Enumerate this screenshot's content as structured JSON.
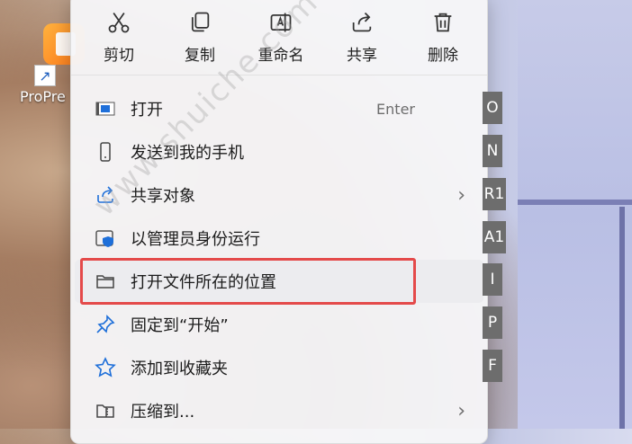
{
  "desktop": {
    "icon_label": "ProPre",
    "shortcut_icon": "shortcut-arrow-icon"
  },
  "toolbar": {
    "items": [
      {
        "label": "剪切",
        "icon": "scissors-icon"
      },
      {
        "label": "复制",
        "icon": "copy-icon"
      },
      {
        "label": "重命名",
        "icon": "rename-icon"
      },
      {
        "label": "共享",
        "icon": "share-icon"
      },
      {
        "label": "删除",
        "icon": "trash-icon"
      }
    ]
  },
  "menu": {
    "items": [
      {
        "label": "打开",
        "shortcut": "Enter",
        "hotkey": "O",
        "icon": "open-app-icon",
        "submenu": false
      },
      {
        "label": "发送到我的手机",
        "hotkey": "N",
        "icon": "phone-icon",
        "submenu": false
      },
      {
        "label": "共享对象",
        "hotkey": "R1",
        "icon": "share-icon",
        "submenu": true
      },
      {
        "label": "以管理员身份运行",
        "hotkey": "A1",
        "icon": "shield-icon",
        "submenu": false
      },
      {
        "label": "打开文件所在的位置",
        "hotkey": "I",
        "icon": "folder-icon",
        "submenu": false,
        "highlighted": true
      },
      {
        "label": "固定到“开始”",
        "hotkey": "P",
        "icon": "pin-icon",
        "submenu": false
      },
      {
        "label": "添加到收藏夹",
        "hotkey": "F",
        "icon": "star-icon",
        "submenu": false
      },
      {
        "label": "压缩到...",
        "icon": "zip-folder-icon",
        "submenu": true
      }
    ],
    "chevron": "›"
  },
  "watermark": "www.shuiche.com",
  "colors": {
    "menu_bg": "#f6f6f8",
    "accent_blue": "#1e6fd9",
    "highlight_box": "#e44a4a",
    "hotkey_bg": "#6d6d6d"
  }
}
